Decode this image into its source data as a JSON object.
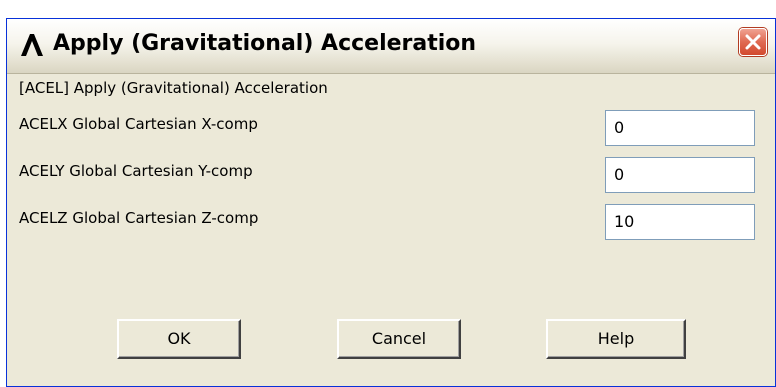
{
  "window": {
    "title": "Apply (Gravitational) Acceleration",
    "close_icon": "close-icon",
    "app_icon": "lambda-icon"
  },
  "header_label": "[ACEL]  Apply (Gravitational) Acceleration",
  "fields": [
    {
      "label": "ACELX  Global Cartesian X-comp",
      "value": "0"
    },
    {
      "label": "ACELY  Global Cartesian Y-comp",
      "value": "0"
    },
    {
      "label": "ACELZ  Global Cartesian Z-comp",
      "value": "10"
    }
  ],
  "buttons": {
    "ok": "OK",
    "cancel": "Cancel",
    "help": "Help"
  },
  "colors": {
    "dialog_background": "#ece9d8",
    "close_button": "#d2492e",
    "window_border": "#0831d9"
  }
}
